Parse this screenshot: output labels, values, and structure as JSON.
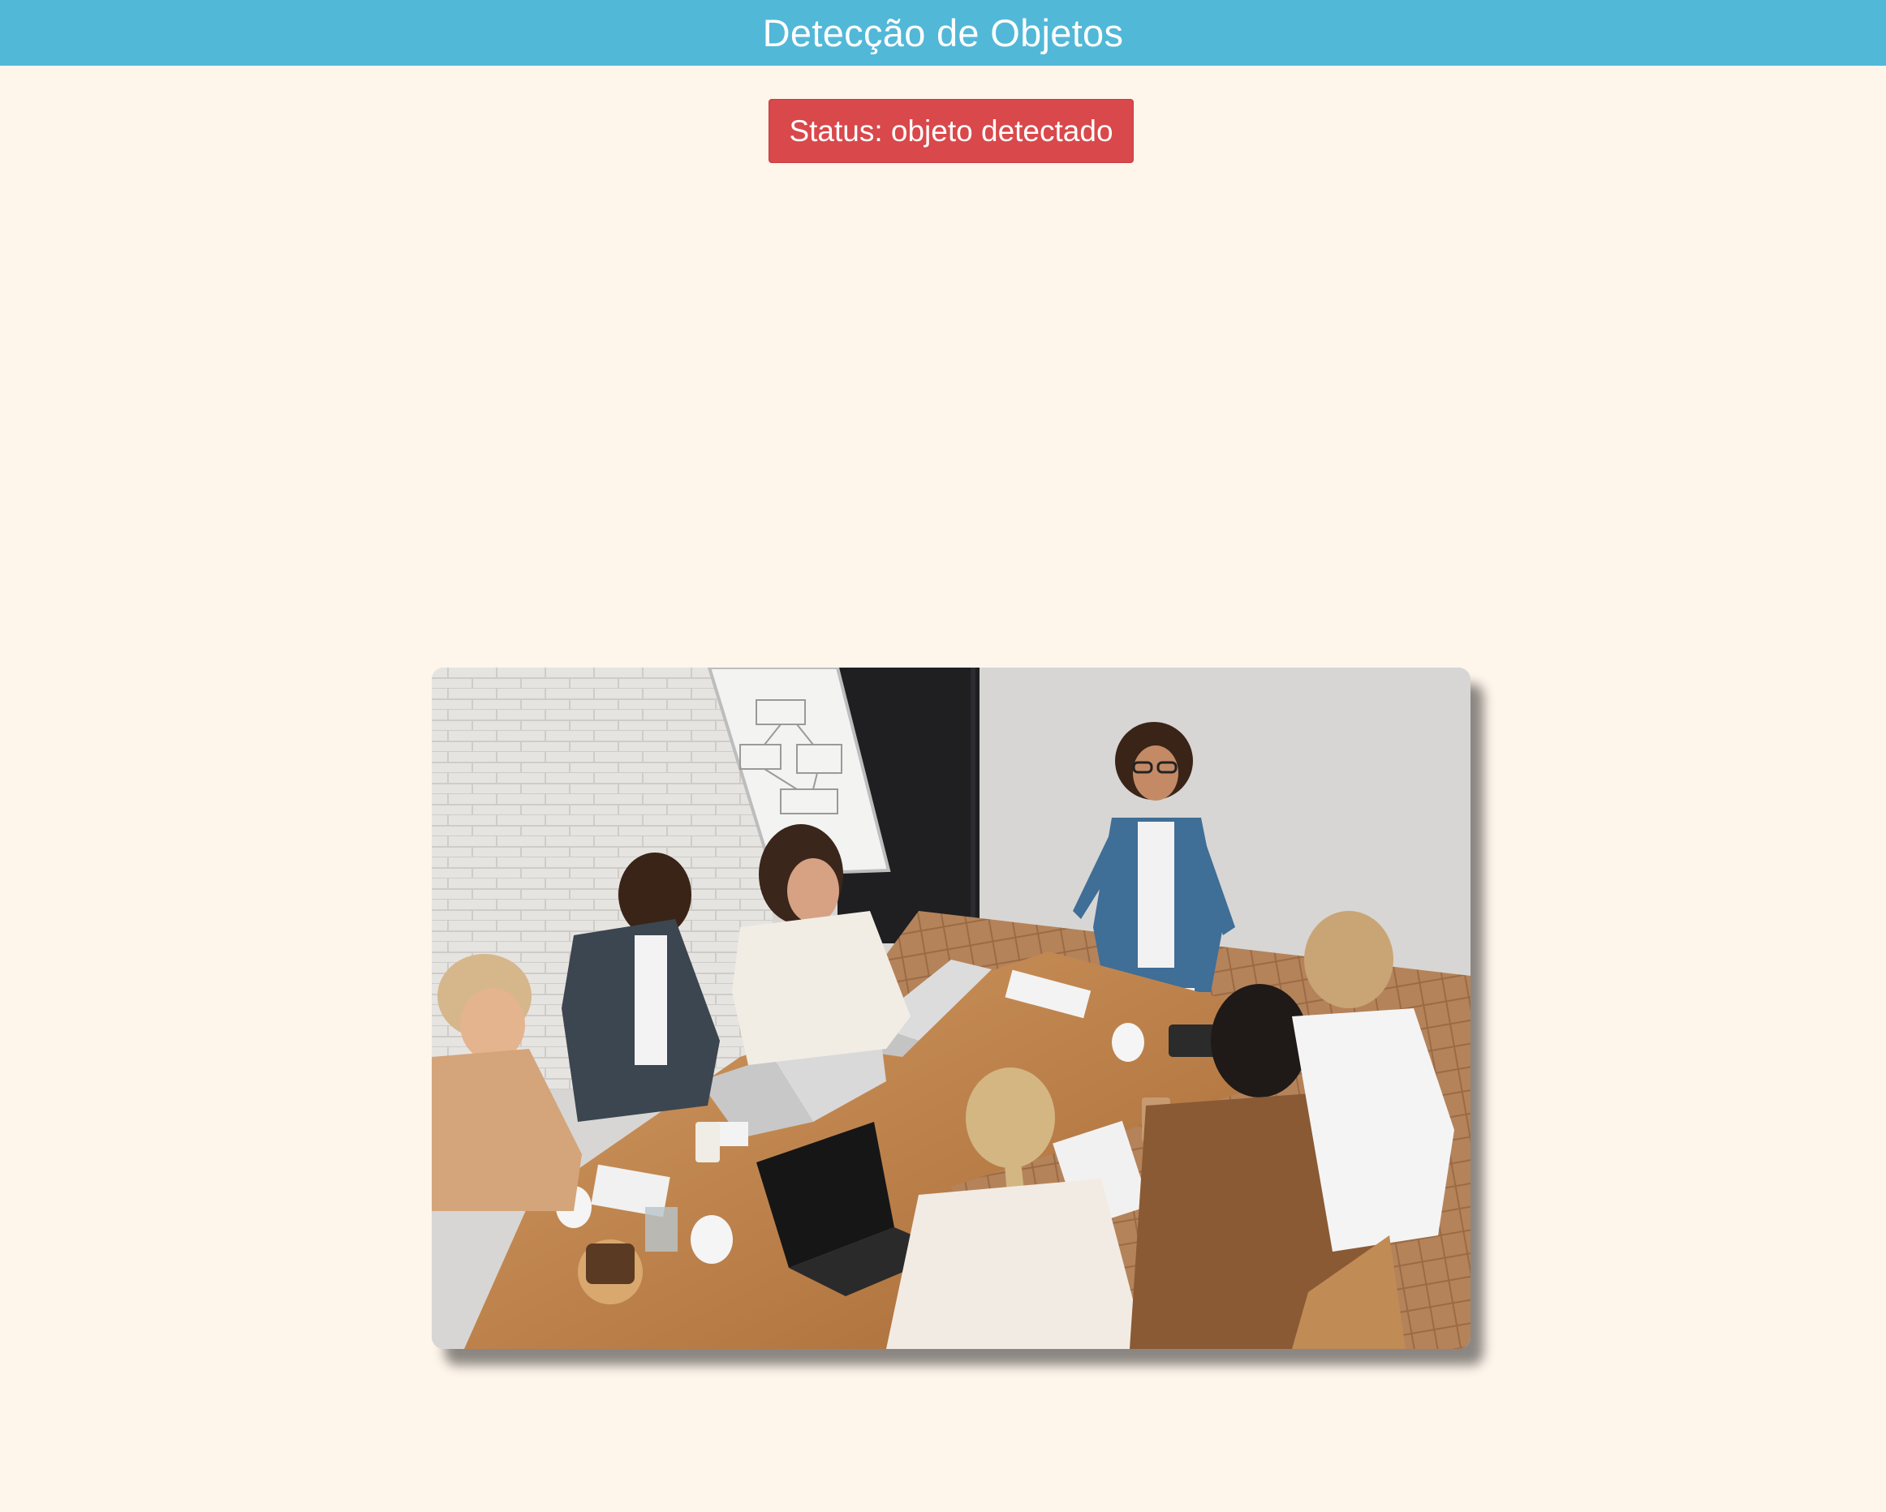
{
  "header": {
    "title": "Detecção de Objetos",
    "background_color": "#52b8d8"
  },
  "status": {
    "label": "Status: objeto detectado",
    "color": "#d9484b"
  },
  "image": {
    "alt": "pessoas em reunião ao redor de uma mesa"
  },
  "colors": {
    "page_background": "#fef5eb"
  }
}
